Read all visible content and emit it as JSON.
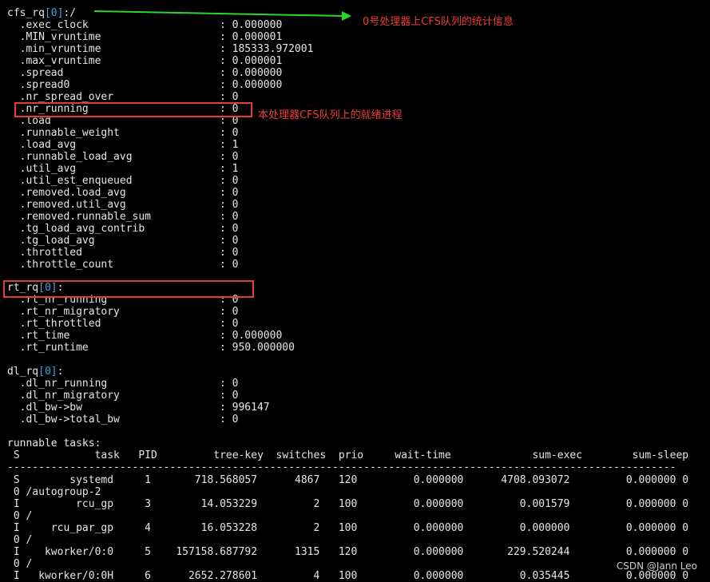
{
  "cfs_rq": {
    "head": "cfs_rq",
    "idx": "[0]",
    "tail": ":/",
    "rows": [
      {
        "key": ".exec_clock",
        "val": "0.000000"
      },
      {
        "key": ".MIN_vruntime",
        "val": "0.000001"
      },
      {
        "key": ".min_vruntime",
        "val": "185333.972001"
      },
      {
        "key": ".max_vruntime",
        "val": "0.000001"
      },
      {
        "key": ".spread",
        "val": "0.000000"
      },
      {
        "key": ".spread0",
        "val": "0.000000"
      },
      {
        "key": ".nr_spread_over",
        "val": "0"
      },
      {
        "key": ".nr_running",
        "val": "0"
      },
      {
        "key": ".load",
        "val": "0"
      },
      {
        "key": ".runnable_weight",
        "val": "0"
      },
      {
        "key": ".load_avg",
        "val": "1"
      },
      {
        "key": ".runnable_load_avg",
        "val": "0"
      },
      {
        "key": ".util_avg",
        "val": "1"
      },
      {
        "key": ".util_est_enqueued",
        "val": "0"
      },
      {
        "key": ".removed.load_avg",
        "val": "0"
      },
      {
        "key": ".removed.util_avg",
        "val": "0"
      },
      {
        "key": ".removed.runnable_sum",
        "val": "0"
      },
      {
        "key": ".tg_load_avg_contrib",
        "val": "0"
      },
      {
        "key": ".tg_load_avg",
        "val": "0"
      },
      {
        "key": ".throttled",
        "val": "0"
      },
      {
        "key": ".throttle_count",
        "val": "0"
      }
    ]
  },
  "rt_rq": {
    "head": "rt_rq",
    "idx": "[0]",
    "tail": ":",
    "rows": [
      {
        "key": ".rt_nr_running",
        "val": "0"
      },
      {
        "key": ".rt_nr_migratory",
        "val": "0"
      },
      {
        "key": ".rt_throttled",
        "val": "0"
      },
      {
        "key": ".rt_time",
        "val": "0.000000"
      },
      {
        "key": ".rt_runtime",
        "val": "950.000000"
      }
    ]
  },
  "dl_rq": {
    "head": "dl_rq",
    "idx": "[0]",
    "tail": ":",
    "rows": [
      {
        "key": ".dl_nr_running",
        "val": "0"
      },
      {
        "key": ".dl_nr_migratory",
        "val": "0"
      },
      {
        "key": ".dl_bw->bw",
        "val": "996147"
      },
      {
        "key": ".dl_bw->total_bw",
        "val": "0"
      }
    ]
  },
  "runnable": {
    "title": "runnable tasks:",
    "header": " S            task   PID         tree-key  switches  prio     wait-time             sum-exec        sum-sleep",
    "separator": "-----------------------------------------------------------------------------------------------------------",
    "lines": [
      " S        systemd     1       718.568057      4867   120         0.000000      4708.093072         0.000000 0",
      " 0 /autogroup-2",
      " I         rcu_gp     3        14.053229         2   100         0.000000         0.001579         0.000000 0",
      " 0 /",
      " I     rcu_par_gp     4        16.053228         2   100         0.000000         0.000000         0.000000 0",
      " 0 /",
      " I    kworker/0:0     5    157158.687792      1315   120         0.000000       229.520244         0.000000 0",
      " 0 /",
      " I   kworker/0:0H     6      2652.278601         4   100         0.000000         0.035445         0.000000 0"
    ]
  },
  "annotations": {
    "cfs_note": "0号处理器上CFS队列的统计信息",
    "running_note": "本处理器CFS队列上的就绪进程"
  },
  "watermark": "CSDN @Jann Leo",
  "colors": {
    "background": "#000000",
    "text": "#e6e6e6",
    "index": "#3ea8d8",
    "highlight": "#e23b3b",
    "arrow": "#2bd62b"
  }
}
